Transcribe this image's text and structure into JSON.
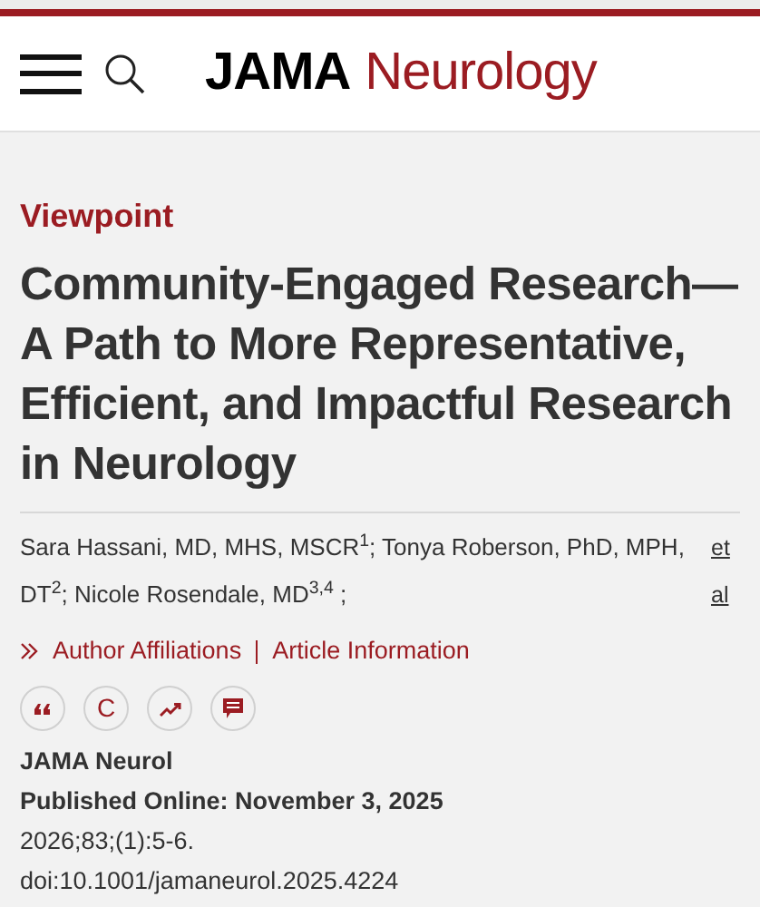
{
  "header": {
    "brand": "JAMA",
    "journal": "Neurology"
  },
  "article_type": "Viewpoint",
  "title": "Community-Engaged Research—A Path to More Representative, Efficient, and Impactful Research in Neurology",
  "authors": "Sara Hassani, MD, MHS, MSCR$^{1}$; Tonya Roberson, PhD, MPH, DT$^{2}$; Nicole Rosendale, MD$^{3,4}$ ;",
  "et_al": "et al",
  "links": [
    {
      "label": "Author Affiliations",
      "kind": "expand"
    },
    {
      "label": "Article Information",
      "kind": "plain"
    }
  ],
  "actions": [
    {
      "kind": "quote"
    },
    {
      "kind": "letter",
      "label": "C"
    },
    {
      "kind": "trend"
    },
    {
      "kind": "comment"
    }
  ],
  "citation": {
    "journal": "JAMA Neurol",
    "published": "Published Online: November 3, 2025",
    "issue": "2026;83;(1):5-6.",
    "doi": "doi:10.1001/jamaneurol.2025.4224"
  }
}
